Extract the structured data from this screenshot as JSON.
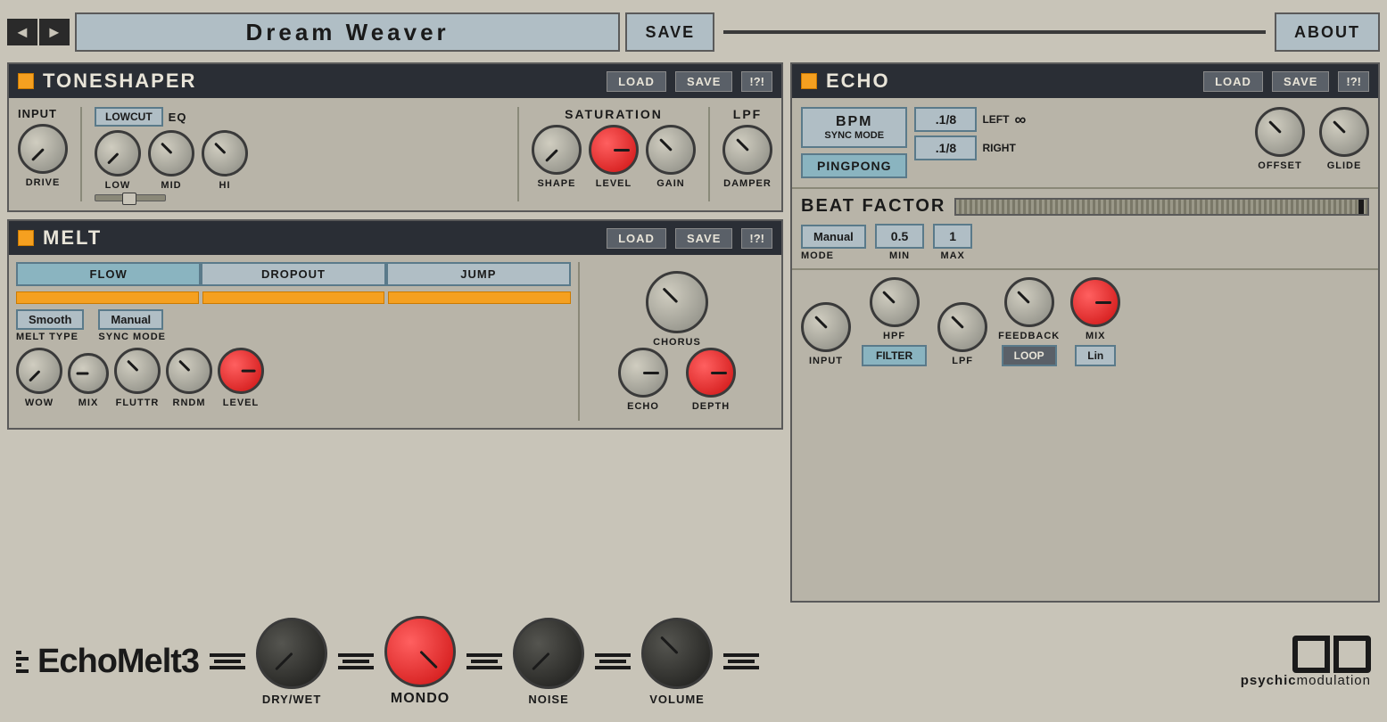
{
  "header": {
    "preset_name": "Dream  Weaver",
    "save_label": "SAVE",
    "about_label": "ABOUT"
  },
  "toneshaper": {
    "title": "TONESHAPER",
    "load": "LOAD",
    "save": "SAVE",
    "warn": "!?!",
    "input_label": "INPUT",
    "lowcut_label": "LOWCUT",
    "eq_label": "EQ",
    "saturation_label": "SATURATION",
    "lpf_label": "LPF",
    "knobs": {
      "drive": "DRIVE",
      "low": "LOW",
      "mid": "MID",
      "hi": "HI",
      "shape": "SHAPE",
      "level": "LEVEL",
      "gain": "GAIN",
      "damper": "DAMPER"
    }
  },
  "melt": {
    "title": "MELT",
    "load": "LOAD",
    "save": "SAVE",
    "warn": "!?!",
    "tabs": [
      "FLOW",
      "DROPOUT",
      "JUMP"
    ],
    "melt_type_label": "Smooth",
    "melt_type_sub": "MELT TYPE",
    "sync_mode_label": "Manual",
    "sync_mode_sub": "SYNC MODE",
    "knobs": {
      "wow": "WOW",
      "mix": "MIX",
      "fluttr": "FLUTTR",
      "rndm": "RNDM",
      "level": "LEVEL"
    },
    "right": {
      "chorus_label": "CHORUS",
      "echo_label": "ECHO",
      "depth_label": "DEPTH"
    }
  },
  "echo": {
    "title": "ECHO",
    "load": "LOAD",
    "save": "SAVE",
    "warn": "!?!",
    "bpm_label": "BPM",
    "sync_mode": "SYNC MODE",
    "left_delay": ".1/8",
    "left_label": "LEFT",
    "infinity": "∞",
    "pingpong": "PINGPONG",
    "right_delay": ".1/8",
    "right_label": "RIGHT",
    "offset_label": "OFFSET",
    "glide_label": "GLIDE",
    "beat_factor_title": "BEAT FACTOR",
    "mode_label": "Manual",
    "mode_sub": "MODE",
    "min_value": "0.5",
    "min_sub": "MIN",
    "max_value": "1",
    "max_sub": "MAX",
    "knobs": {
      "input": "INPUT",
      "hpf": "HPF",
      "lpf": "LPF",
      "feedback": "FEEDBACK",
      "mix": "MIX"
    },
    "filter_btn": "FILTER",
    "loop_btn": "LOOP",
    "lin_btn": "Lin"
  },
  "bottom": {
    "logo": "EchoMelt3",
    "knobs": {
      "dry_wet": "DRY/WET",
      "mondo": "MONDO",
      "noise": "NOISE",
      "volume": "VOLUME"
    },
    "brand": "psychicmodulation"
  }
}
